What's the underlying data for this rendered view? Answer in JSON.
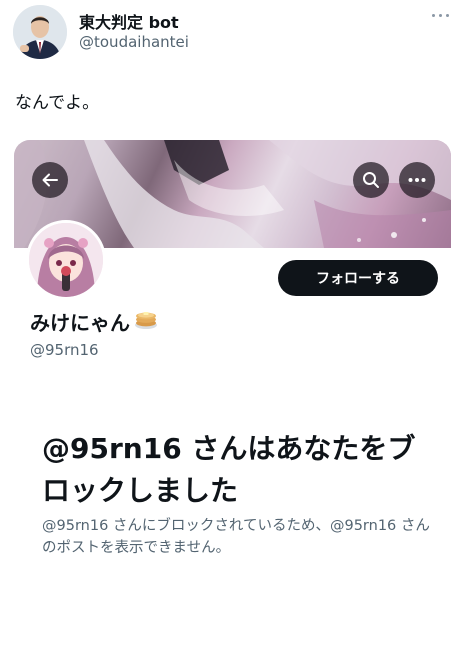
{
  "tweet": {
    "author_name": "東大判定 bot",
    "author_handle": "@toudaihantei",
    "text": "なんでよ。",
    "more_icon": "more-horizontal-icon"
  },
  "profile": {
    "name": "みけにゃん",
    "name_icon": "pancake-icon",
    "handle": "@95rn16",
    "follow_label": "フォローする",
    "back_icon": "arrow-left-icon",
    "search_icon": "search-icon",
    "more_icon": "more-horizontal-icon"
  },
  "blocked": {
    "title": "@95rn16 さんはあなたをブロックしました",
    "description": "@95rn16 さんにブロックされているため、@95rn16 さんのポストを表示できません。"
  },
  "colors": {
    "text_primary": "#0f1419",
    "text_secondary": "#536471",
    "button_dark": "#0f1419"
  }
}
